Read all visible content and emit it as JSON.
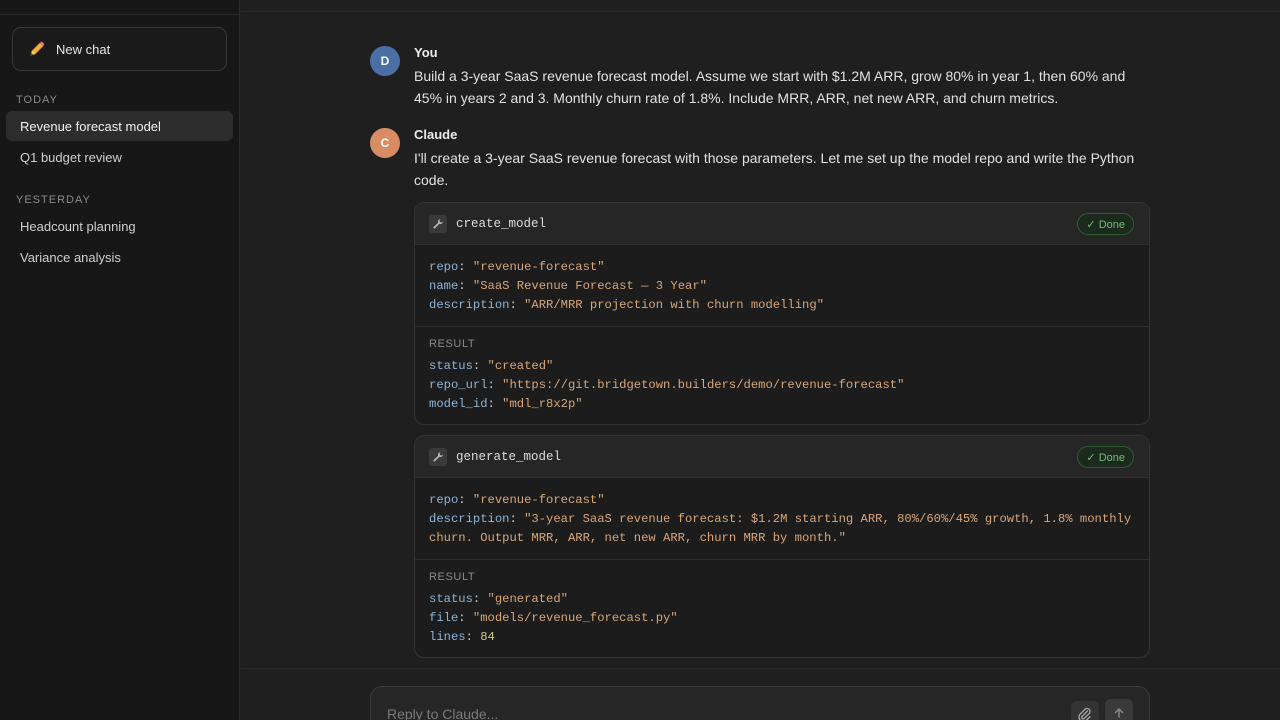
{
  "sidebar": {
    "new_chat_label": "New chat",
    "sections": [
      {
        "label": "TODAY",
        "items": [
          "Revenue forecast model",
          "Q1 budget review"
        ]
      },
      {
        "label": "YESTERDAY",
        "items": [
          "Headcount planning",
          "Variance analysis"
        ]
      }
    ],
    "active_item": "Revenue forecast model"
  },
  "conversation": {
    "user": {
      "initial": "D",
      "name": "You",
      "text": "Build a 3-year SaaS revenue forecast model. Assume we start with $1.2M ARR, grow 80% in year 1, then 60% and 45% in years 2 and 3. Monthly churn rate of 1.8%. Include MRR, ARR, net new ARR, and churn metrics."
    },
    "assistant": {
      "initial": "C",
      "name": "Claude",
      "text": "I'll create a 3-year SaaS revenue forecast with those parameters. Let me set up the model repo and write the Python code."
    },
    "tools": [
      {
        "name": "create_model",
        "status": "✓ Done",
        "input": {
          "repo": "\"revenue-forecast\"",
          "name": "\"SaaS Revenue Forecast — 3 Year\"",
          "description": "\"ARR/MRR projection with churn modelling\""
        },
        "result_label": "RESULT",
        "result": {
          "status": "\"created\"",
          "repo_url": "\"https://git.bridgetown.builders/demo/revenue-forecast\"",
          "model_id": "\"mdl_r8x2p\""
        }
      },
      {
        "name": "generate_model",
        "status": "✓ Done",
        "input": {
          "repo": "\"revenue-forecast\"",
          "description": "\"3-year SaaS revenue forecast: $1.2M starting ARR, 80%/60%/45% growth, 1.8% monthly churn. Output MRR, ARR, net new ARR, churn MRR by month.\""
        },
        "result_label": "RESULT",
        "result": {
          "status": "\"generated\"",
          "file": "\"models/revenue_forecast.py\"",
          "lines": "84"
        }
      }
    ]
  },
  "composer": {
    "placeholder": "Reply to Claude..."
  },
  "icons": {
    "new_chat": "pencil-icon",
    "tool": "wrench-icon",
    "attach": "paperclip-icon",
    "send": "arrow-up-icon"
  },
  "colors": {
    "background": "#1f1f1f",
    "sidebar": "#171717",
    "user_avatar": "#4a6fa5",
    "claude_avatar": "#d98c63",
    "done_badge": "#6ebd72",
    "code_key": "#8ab4d8",
    "code_string": "#d9a676"
  }
}
